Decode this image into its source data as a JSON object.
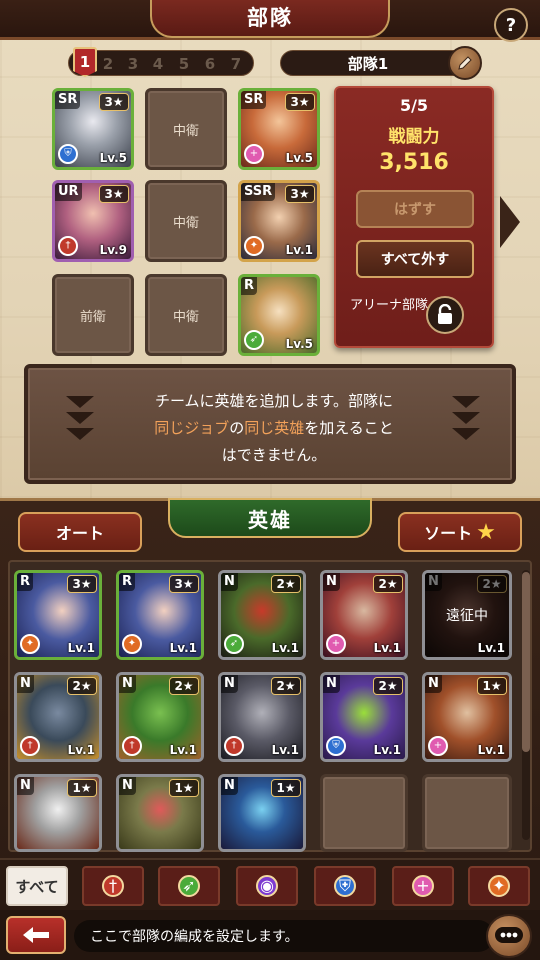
{
  "header": {
    "title": "部隊",
    "help_label": "?"
  },
  "squad_pages": {
    "items": [
      "1",
      "2",
      "3",
      "4",
      "5",
      "6",
      "7"
    ],
    "active_index": 0
  },
  "squad_name": "部隊1",
  "formation": {
    "slots": [
      {
        "type": "hero",
        "rarity": "SR",
        "stars": "3★",
        "level": "Lv.5",
        "class_icon": "shield-icon",
        "frame_color": "#6ab03a"
      },
      {
        "type": "empty",
        "label": "中衛"
      },
      {
        "type": "hero",
        "rarity": "SR",
        "stars": "3★",
        "level": "Lv.5",
        "class_icon": "heal-icon",
        "frame_color": "#6ab03a"
      },
      {
        "type": "hero",
        "rarity": "UR",
        "stars": "3★",
        "level": "Lv.9",
        "class_icon": "sword-icon",
        "frame_color": "#a05fb0"
      },
      {
        "type": "empty",
        "label": "中衛"
      },
      {
        "type": "hero",
        "rarity": "SSR",
        "stars": "3★",
        "level": "Lv.1",
        "class_icon": "fire-icon",
        "frame_color": "#d3a34a"
      },
      {
        "type": "empty",
        "label": "前衛"
      },
      {
        "type": "empty",
        "label": "中衛"
      },
      {
        "type": "hero",
        "rarity": "R",
        "stars": "",
        "level": "Lv.5",
        "class_icon": "bow-icon",
        "frame_color": "#6ab03a"
      }
    ]
  },
  "power_panel": {
    "count": "5/5",
    "label": "戦闘力",
    "value": "3,516",
    "remove_button": "はずす",
    "remove_all_button": "すべて外す",
    "arena_label": "アリーナ部隊"
  },
  "message": {
    "line1": "チームに英雄を追加します。部隊に",
    "line2_part1": "同じジョブ",
    "line2_part2": "の",
    "line2_part3": "同じ英雄",
    "line2_part4": "を加えること",
    "line3": "はできません。"
  },
  "heroes_section": {
    "title": "英雄",
    "auto_button": "オート",
    "sort_button": "ソート",
    "heroes": [
      {
        "rarity": "R",
        "stars": "3★",
        "level": "Lv.1",
        "class": "fire",
        "frame": "r-green",
        "away": ""
      },
      {
        "rarity": "R",
        "stars": "3★",
        "level": "Lv.1",
        "class": "fire",
        "frame": "r-green",
        "away": ""
      },
      {
        "rarity": "N",
        "stars": "2★",
        "level": "Lv.1",
        "class": "bow",
        "frame": "n",
        "away": ""
      },
      {
        "rarity": "N",
        "stars": "2★",
        "level": "Lv.1",
        "class": "heal",
        "frame": "n",
        "away": ""
      },
      {
        "rarity": "N",
        "stars": "2★",
        "level": "Lv.1",
        "class": "",
        "frame": "n",
        "away": "遠征中"
      },
      {
        "rarity": "N",
        "stars": "2★",
        "level": "Lv.1",
        "class": "sword",
        "frame": "n",
        "away": ""
      },
      {
        "rarity": "N",
        "stars": "2★",
        "level": "Lv.1",
        "class": "sword",
        "frame": "n",
        "away": ""
      },
      {
        "rarity": "N",
        "stars": "2★",
        "level": "Lv.1",
        "class": "sword",
        "frame": "n",
        "away": ""
      },
      {
        "rarity": "N",
        "stars": "2★",
        "level": "Lv.1",
        "class": "shield",
        "frame": "n",
        "away": ""
      },
      {
        "rarity": "N",
        "stars": "1★",
        "level": "Lv.1",
        "class": "heal",
        "frame": "n",
        "away": ""
      },
      {
        "rarity": "N",
        "stars": "1★",
        "level": "",
        "class": "",
        "frame": "n",
        "away": ""
      },
      {
        "rarity": "N",
        "stars": "1★",
        "level": "",
        "class": "",
        "frame": "n",
        "away": ""
      },
      {
        "rarity": "N",
        "stars": "1★",
        "level": "",
        "class": "",
        "frame": "n",
        "away": ""
      }
    ]
  },
  "filter_tabs": {
    "all_label": "すべて",
    "icons": [
      "sword-icon",
      "bow-icon",
      "mask-icon",
      "shield-icon",
      "heal-icon",
      "fire-icon"
    ]
  },
  "status_bar": {
    "message": "ここで部隊の編成を設定します。"
  },
  "colors": {
    "accent_red": "#8a2a24",
    "gold": "#ffe36a",
    "highlight_orange": "#f2a15a",
    "green_title": "#2f6a2a"
  }
}
